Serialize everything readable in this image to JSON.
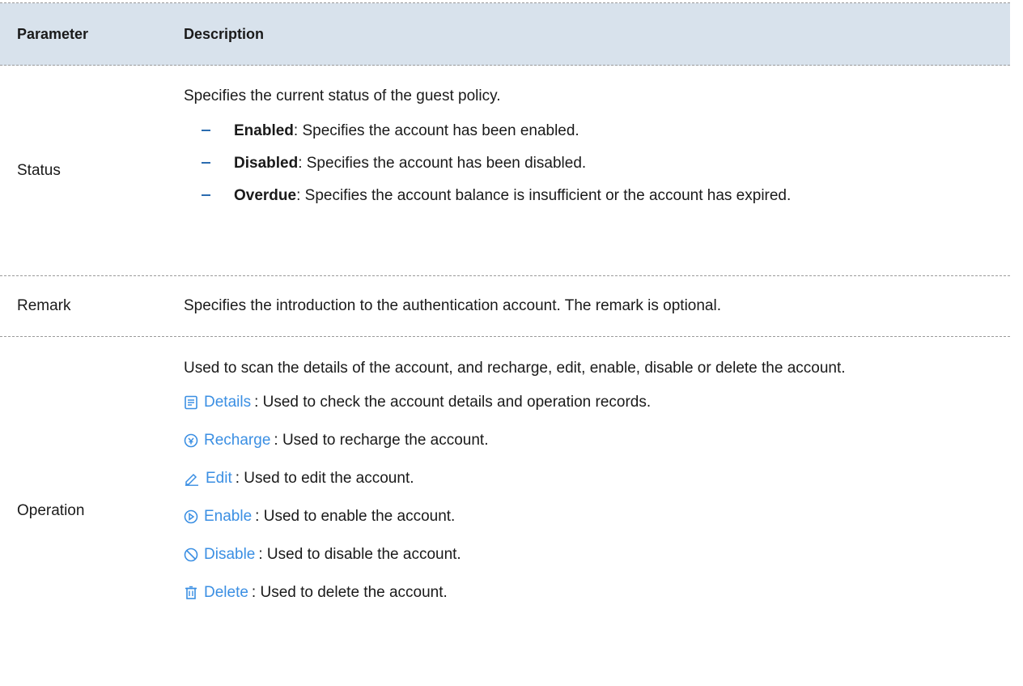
{
  "table": {
    "headers": [
      "Parameter",
      "Description"
    ],
    "status": {
      "param": "Status",
      "intro": "Specifies the current status of the guest policy.",
      "items": [
        {
          "term": "Enabled",
          "text": ": Specifies the account has been enabled."
        },
        {
          "term": "Disabled",
          "text": ": Specifies the account has been disabled."
        },
        {
          "term": "Overdue",
          "text": ": Specifies the account balance is insufficient or the account has expired."
        }
      ]
    },
    "remark": {
      "param": "Remark",
      "text": "Specifies the introduction to the authentication account. The remark is optional."
    },
    "operation": {
      "param": "Operation",
      "intro": "Used to scan the details of the account, and recharge, edit, enable, disable or delete the account.",
      "items": [
        {
          "icon": "details-icon",
          "label": "Details",
          "text": " : Used to check the account details and operation records."
        },
        {
          "icon": "recharge-icon",
          "label": "Recharge",
          "text": " : Used to recharge the account."
        },
        {
          "icon": "edit-icon",
          "label": "Edit",
          "text": ": Used to edit the account."
        },
        {
          "icon": "enable-icon",
          "label": "Enable",
          "text": ": Used to enable the account."
        },
        {
          "icon": "disable-icon",
          "label": "Disable",
          "text": " : Used to disable the account."
        },
        {
          "icon": "delete-icon",
          "label": "Delete",
          "text": " : Used to delete the account."
        }
      ]
    }
  },
  "colors": {
    "header_bg": "#d8e2ec",
    "link": "#3b8fe3",
    "dash": "#2b6cb0",
    "divider": "#9a9a9a"
  }
}
